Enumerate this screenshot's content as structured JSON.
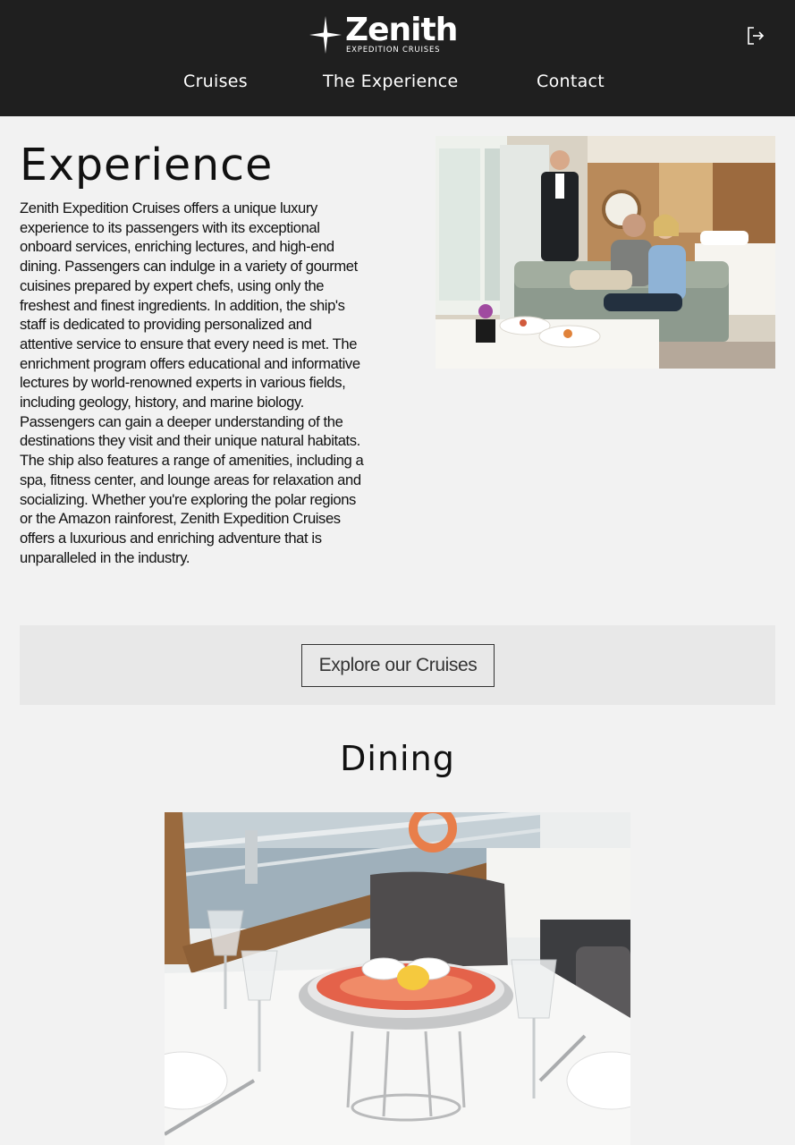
{
  "brand": {
    "name": "Zenith",
    "tagline": "EXPEDITION CRUISES"
  },
  "nav": {
    "items": [
      "Cruises",
      "The Experience",
      "Contact"
    ]
  },
  "experience": {
    "title": "Experience",
    "body": "Zenith Expedition Cruises offers a unique luxury experience to its passengers with its exceptional onboard services, enriching lectures, and high-end dining. Passengers can indulge in a variety of gourmet cuisines prepared by expert chefs, using only the freshest and finest ingredients. In addition, the ship's staff is dedicated to providing personalized and attentive service to ensure that every need is met. The enrichment program offers educational and informative lectures by world-renowned experts in various fields, including geology, history, and marine biology. Passengers can gain a deeper understanding of the destinations they visit and their unique natural habitats. The ship also features a range of amenities, including a spa, fitness center, and lounge areas for relaxation and socializing. Whether you're exploring the polar regions or the Amazon rainforest, Zenith Expedition Cruises offers a luxurious and enriching adventure that is unparalleled in the industry."
  },
  "cta": {
    "label": "Explore our Cruises"
  },
  "dining": {
    "title": "Dining"
  },
  "icons": {
    "logo": "four-point-star-icon",
    "logout": "logout-icon"
  },
  "colors": {
    "header_bg": "#1f1f1f",
    "page_bg": "#f2f2f2",
    "cta_band": "#e8e8e8"
  }
}
